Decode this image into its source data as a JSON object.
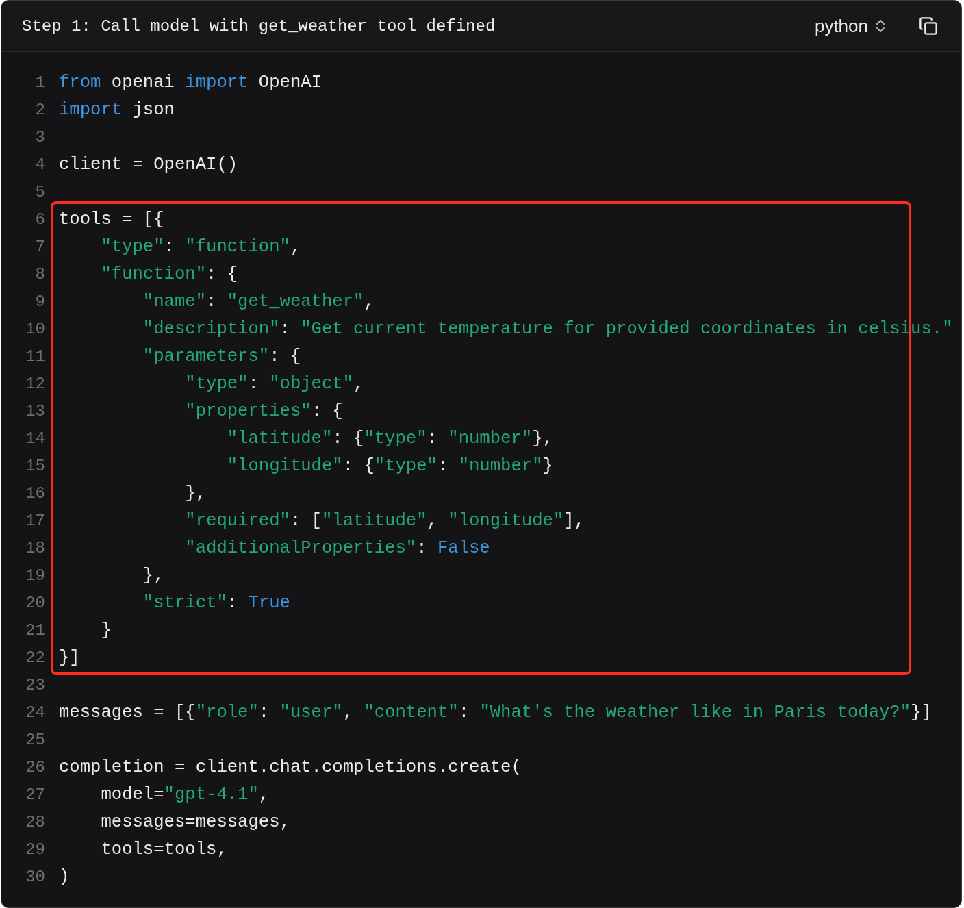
{
  "header": {
    "title": "Step 1: Call model with get_weather tool defined",
    "language": "python"
  },
  "code": {
    "blocks": [
      {
        "highlighted": false,
        "lines": [
          {
            "number": "1",
            "tokens": [
              {
                "kind": "keyword",
                "text": "from"
              },
              {
                "kind": "plain",
                "text": " openai "
              },
              {
                "kind": "keyword",
                "text": "import"
              },
              {
                "kind": "plain",
                "text": " OpenAI"
              }
            ]
          },
          {
            "number": "2",
            "tokens": [
              {
                "kind": "keyword",
                "text": "import"
              },
              {
                "kind": "plain",
                "text": " json"
              }
            ]
          },
          {
            "number": "3"
          },
          {
            "number": "4",
            "tokens": [
              {
                "kind": "plain",
                "text": "client = OpenAI()"
              }
            ]
          },
          {
            "number": "5"
          }
        ]
      },
      {
        "highlighted": true,
        "lines": [
          {
            "number": "6",
            "tokens": [
              {
                "kind": "plain",
                "text": "tools = [{"
              }
            ]
          },
          {
            "number": "7",
            "tokens": [
              {
                "kind": "string",
                "text": "    \"type\""
              },
              {
                "kind": "plain",
                "text": ": "
              },
              {
                "kind": "string",
                "text": "\"function\""
              },
              {
                "kind": "plain",
                "text": ","
              }
            ]
          },
          {
            "number": "8",
            "tokens": [
              {
                "kind": "string",
                "text": "    \"function\""
              },
              {
                "kind": "plain",
                "text": ": {"
              }
            ]
          },
          {
            "number": "9",
            "tokens": [
              {
                "kind": "string",
                "text": "        \"name\""
              },
              {
                "kind": "plain",
                "text": ": "
              },
              {
                "kind": "string",
                "text": "\"get_weather\""
              },
              {
                "kind": "plain",
                "text": ","
              }
            ]
          },
          {
            "number": "10",
            "tokens": [
              {
                "kind": "string",
                "text": "        \"description\""
              },
              {
                "kind": "plain",
                "text": ": "
              },
              {
                "kind": "string",
                "text": "\"Get current temperature for provided coordinates in celsius.\""
              }
            ]
          },
          {
            "number": "11",
            "tokens": [
              {
                "kind": "string",
                "text": "        \"parameters\""
              },
              {
                "kind": "plain",
                "text": ": {"
              }
            ]
          },
          {
            "number": "12",
            "tokens": [
              {
                "kind": "string",
                "text": "            \"type\""
              },
              {
                "kind": "plain",
                "text": ": "
              },
              {
                "kind": "string",
                "text": "\"object\""
              },
              {
                "kind": "plain",
                "text": ","
              }
            ]
          },
          {
            "number": "13",
            "tokens": [
              {
                "kind": "string",
                "text": "            \"properties\""
              },
              {
                "kind": "plain",
                "text": ": {"
              }
            ]
          },
          {
            "number": "14",
            "tokens": [
              {
                "kind": "string",
                "text": "                \"latitude\""
              },
              {
                "kind": "plain",
                "text": ": {"
              },
              {
                "kind": "string",
                "text": "\"type\""
              },
              {
                "kind": "plain",
                "text": ": "
              },
              {
                "kind": "string",
                "text": "\"number\""
              },
              {
                "kind": "plain",
                "text": "},"
              }
            ]
          },
          {
            "number": "15",
            "tokens": [
              {
                "kind": "string",
                "text": "                \"longitude\""
              },
              {
                "kind": "plain",
                "text": ": {"
              },
              {
                "kind": "string",
                "text": "\"type\""
              },
              {
                "kind": "plain",
                "text": ": "
              },
              {
                "kind": "string",
                "text": "\"number\""
              },
              {
                "kind": "plain",
                "text": "}"
              }
            ]
          },
          {
            "number": "16",
            "tokens": [
              {
                "kind": "plain",
                "text": "            },"
              }
            ]
          },
          {
            "number": "17",
            "tokens": [
              {
                "kind": "string",
                "text": "            \"required\""
              },
              {
                "kind": "plain",
                "text": ": ["
              },
              {
                "kind": "string",
                "text": "\"latitude\""
              },
              {
                "kind": "plain",
                "text": ", "
              },
              {
                "kind": "string",
                "text": "\"longitude\""
              },
              {
                "kind": "plain",
                "text": "],"
              }
            ]
          },
          {
            "number": "18",
            "tokens": [
              {
                "kind": "string",
                "text": "            \"additionalProperties\""
              },
              {
                "kind": "plain",
                "text": ": "
              },
              {
                "kind": "keyword",
                "text": "False"
              }
            ]
          },
          {
            "number": "19",
            "tokens": [
              {
                "kind": "plain",
                "text": "        },"
              }
            ]
          },
          {
            "number": "20",
            "tokens": [
              {
                "kind": "string",
                "text": "        \"strict\""
              },
              {
                "kind": "plain",
                "text": ": "
              },
              {
                "kind": "keyword",
                "text": "True"
              }
            ]
          },
          {
            "number": "21",
            "tokens": [
              {
                "kind": "plain",
                "text": "    }"
              }
            ]
          },
          {
            "number": "22",
            "tokens": [
              {
                "kind": "plain",
                "text": "}]"
              }
            ]
          }
        ]
      },
      {
        "highlighted": false,
        "lines": [
          {
            "number": "23"
          },
          {
            "number": "24",
            "tokens": [
              {
                "kind": "plain",
                "text": "messages = [{"
              },
              {
                "kind": "string",
                "text": "\"role\""
              },
              {
                "kind": "plain",
                "text": ": "
              },
              {
                "kind": "string",
                "text": "\"user\""
              },
              {
                "kind": "plain",
                "text": ", "
              },
              {
                "kind": "string",
                "text": "\"content\""
              },
              {
                "kind": "plain",
                "text": ": "
              },
              {
                "kind": "string",
                "text": "\"What's the weather like in Paris today?\""
              },
              {
                "kind": "plain",
                "text": "}]"
              }
            ]
          },
          {
            "number": "25"
          },
          {
            "number": "26",
            "tokens": [
              {
                "kind": "plain",
                "text": "completion = client.chat.completions.create("
              }
            ]
          },
          {
            "number": "27",
            "tokens": [
              {
                "kind": "plain",
                "text": "    model="
              },
              {
                "kind": "string",
                "text": "\"gpt-4.1\""
              },
              {
                "kind": "plain",
                "text": ","
              }
            ]
          },
          {
            "number": "28",
            "tokens": [
              {
                "kind": "plain",
                "text": "    messages=messages,"
              }
            ]
          },
          {
            "number": "29",
            "tokens": [
              {
                "kind": "plain",
                "text": "    tools=tools,"
              }
            ]
          },
          {
            "number": "30",
            "tokens": [
              {
                "kind": "plain",
                "text": ")"
              }
            ]
          }
        ]
      }
    ]
  }
}
